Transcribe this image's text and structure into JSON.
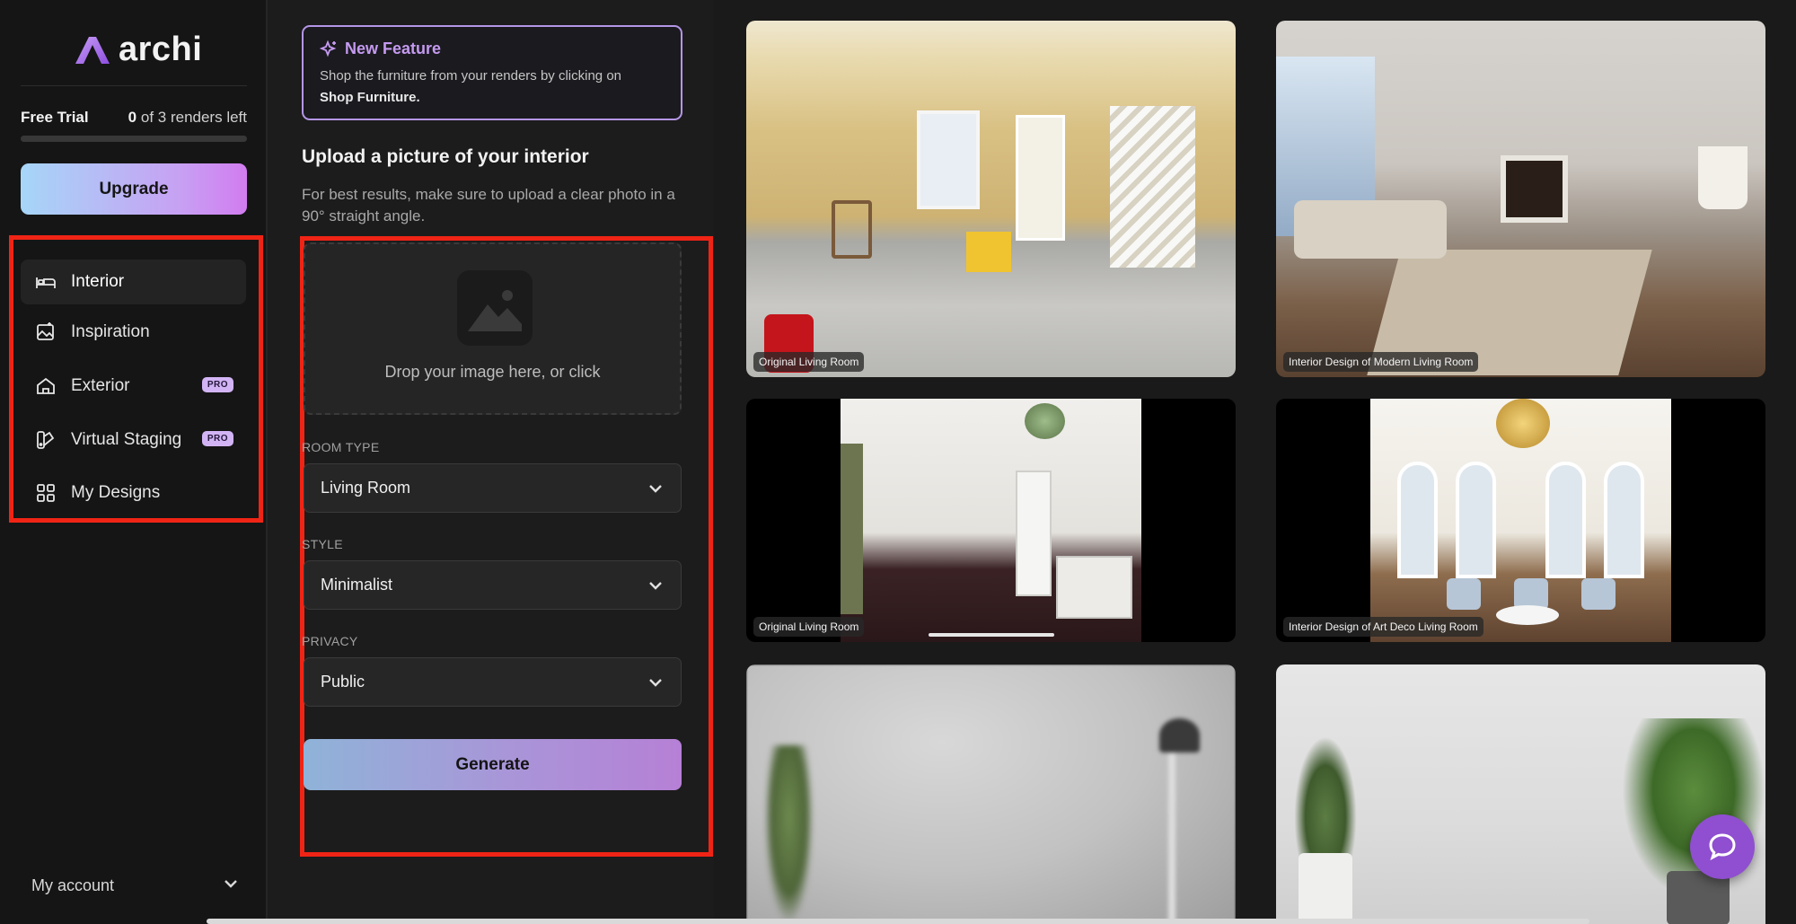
{
  "app": {
    "logo_text": "archi"
  },
  "trial": {
    "label": "Free Trial",
    "renders_used": "0",
    "renders_suffix": "of 3 renders left",
    "progress_fraction": 0
  },
  "upgrade_label": "Upgrade",
  "sidebar": {
    "items": [
      {
        "label": "Interior",
        "icon": "bed-icon",
        "active": true,
        "badge": ""
      },
      {
        "label": "Inspiration",
        "icon": "sparkle-image-icon",
        "active": false,
        "badge": ""
      },
      {
        "label": "Exterior",
        "icon": "house-icon",
        "active": false,
        "badge": "PRO"
      },
      {
        "label": "Virtual Staging",
        "icon": "paint-icon",
        "active": false,
        "badge": "PRO"
      },
      {
        "label": "My Designs",
        "icon": "grid-icon",
        "active": false,
        "badge": ""
      }
    ],
    "account_label": "My account"
  },
  "feature": {
    "title": "New Feature",
    "text": "Shop the furniture from your renders by clicking on",
    "text_bold": "Shop Furniture."
  },
  "upload": {
    "heading": "Upload a picture of your interior",
    "subtitle": "For best results, make sure to upload a clear photo in a 90° straight angle.",
    "dropzone_text": "Drop your image here, or click"
  },
  "form": {
    "room_type": {
      "label": "ROOM TYPE",
      "value": "Living Room"
    },
    "style": {
      "label": "STYLE",
      "value": "Minimalist"
    },
    "privacy": {
      "label": "PRIVACY",
      "value": "Public"
    },
    "generate_label": "Generate"
  },
  "gallery": {
    "tiles": [
      {
        "caption": "Original Living Room"
      },
      {
        "caption": "Interior Design of Modern Living Room"
      },
      {
        "caption": "Original Living Room"
      },
      {
        "caption": "Interior Design of Art Deco Living Room"
      },
      {
        "caption": ""
      },
      {
        "caption": ""
      }
    ]
  },
  "colors": {
    "accent_purple": "#c59af0",
    "highlight_red": "#f02415",
    "chat_purple": "#8f4fd0"
  }
}
